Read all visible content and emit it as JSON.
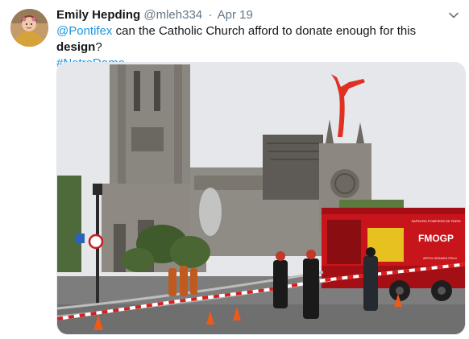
{
  "tweet": {
    "display_name": "Emily Hepding",
    "handle": "@mleh334",
    "separator": "·",
    "date": "Apr 19",
    "mention": "@Pontifex",
    "text_middle": " can the Catholic Church afford to donate enough for this ",
    "text_bold": "design",
    "text_end": "?",
    "hashtag": "#NotreDame"
  },
  "photo": {
    "truck_brand": "FMOGP",
    "truck_top_text": "SAPEURS-POMPIERS DE PARIS",
    "truck_side_text": "APPUI GRANDS FEUX"
  },
  "colors": {
    "link": "#1b95e0",
    "name": "#14171a",
    "muted": "#657786",
    "truck_red": "#c8141b",
    "inflatable": "#e03024"
  }
}
